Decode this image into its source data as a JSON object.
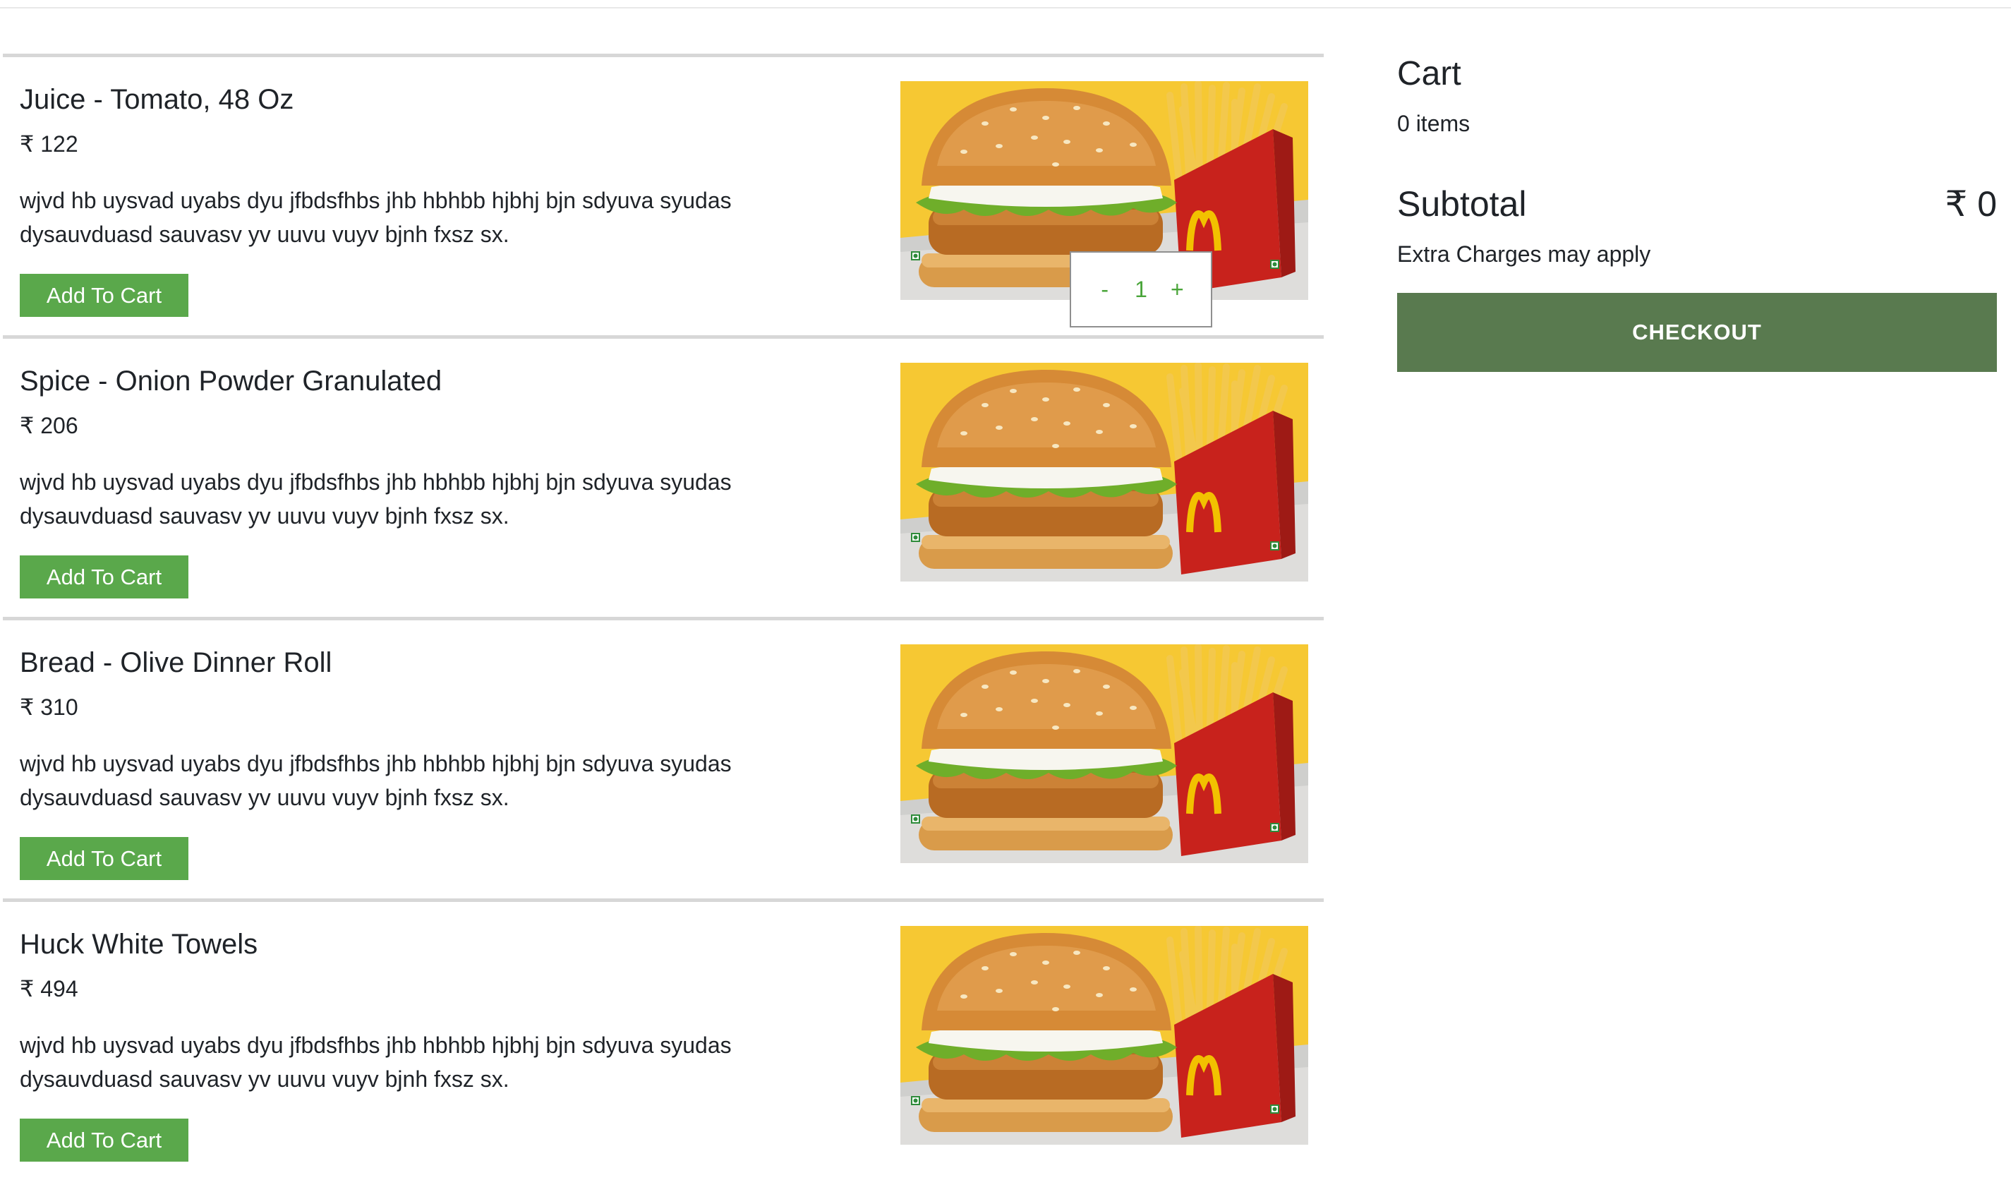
{
  "menu": {
    "items": [
      {
        "title": "Juice - Tomato, 48 Oz",
        "price": "₹ 122",
        "description": "wjvd hb uysvad uyabs dyu jfbdsfhbs jhb hbhbb hjbhj bjn sdyuva syudas dysauvduasd sauvasv yv uuvu vuyv bjnh fxsz sx.",
        "add_label": "Add To Cart",
        "image": "burger-and-fries-image"
      },
      {
        "title": "Spice - Onion Powder Granulated",
        "price": "₹ 206",
        "description": "wjvd hb uysvad uyabs dyu jfbdsfhbs jhb hbhbb hjbhj bjn sdyuva syudas dysauvduasd sauvasv yv uuvu vuyv bjnh fxsz sx.",
        "add_label": "Add To Cart",
        "image": "burger-and-fries-image"
      },
      {
        "title": "Bread - Olive Dinner Roll",
        "price": "₹ 310",
        "description": "wjvd hb uysvad uyabs dyu jfbdsfhbs jhb hbhbb hjbhj bjn sdyuva syudas dysauvduasd sauvasv yv uuvu vuyv bjnh fxsz sx.",
        "add_label": "Add To Cart",
        "image": "burger-and-fries-image"
      },
      {
        "title": "Huck White Towels",
        "price": "₹ 494",
        "description": "wjvd hb uysvad uyabs dyu jfbdsfhbs jhb hbhbb hjbhj bjn sdyuva syudas dysauvduasd sauvasv yv uuvu vuyv bjnh fxsz sx.",
        "add_label": "Add To Cart",
        "image": "burger-and-fries-image"
      }
    ],
    "stepper": {
      "minus": "-",
      "quantity": "1",
      "plus": "+"
    }
  },
  "cart": {
    "title": "Cart",
    "count": "0 items",
    "subtotal_label": "Subtotal",
    "subtotal_value": "₹ 0",
    "extra_charges": "Extra Charges may apply",
    "checkout_label": "CHECKOUT"
  },
  "colors": {
    "add_button": "#5aa84b",
    "checkout_button": "#597a4f",
    "stepper_text": "#4aa53a",
    "divider": "#d7d7d7",
    "image_background": "#f6c833"
  }
}
